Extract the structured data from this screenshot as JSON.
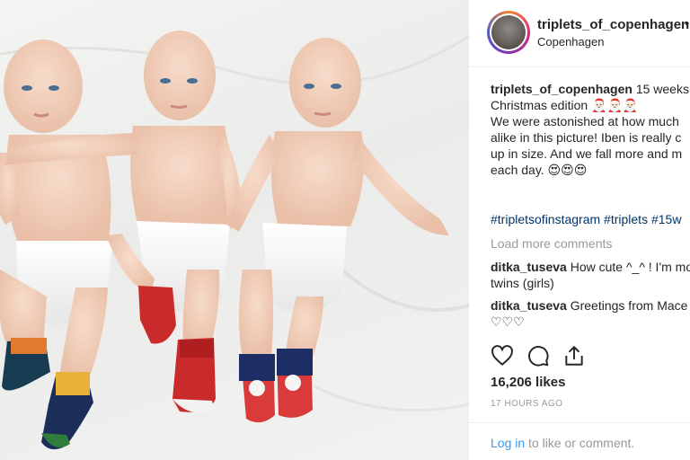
{
  "post": {
    "image_alt": "Three babies in diapers and Christmas socks lying on a white blanket",
    "author": {
      "username": "triplets_of_copenhagen",
      "separator": "•",
      "location": "Copenhagen"
    },
    "caption": {
      "username": "triplets_of_copenhagen",
      "lines": [
        "15 weeks",
        "Christmas edition 🎅🏻🎅🏻🎅🏻",
        "We were astonished at how much",
        "alike in this picture! Iben is really c",
        "up in size. And we fall more and m",
        "each day. 😍😍😍"
      ]
    },
    "hashtags": "#tripletsofinstagram #triplets #15w",
    "load_more": "Load more comments",
    "comments": [
      {
        "username": "ditka_tuseva",
        "lines": [
          "How cute ^_^ ! I'm mo",
          "twins (girls)"
        ]
      },
      {
        "username": "ditka_tuseva",
        "lines": [
          "Greetings from Mace",
          "♡♡♡"
        ]
      }
    ],
    "actions": {
      "like_icon": "heart-icon",
      "comment_icon": "comment-icon",
      "share_icon": "share-icon"
    },
    "likes": "16,206 likes",
    "timestamp": "17 HOURS AGO",
    "login": {
      "link": "Log in",
      "rest": " to like or comment."
    }
  },
  "colors": {
    "link": "#3897f0",
    "hashtag": "#003569",
    "muted": "#999999",
    "text": "#262626"
  }
}
